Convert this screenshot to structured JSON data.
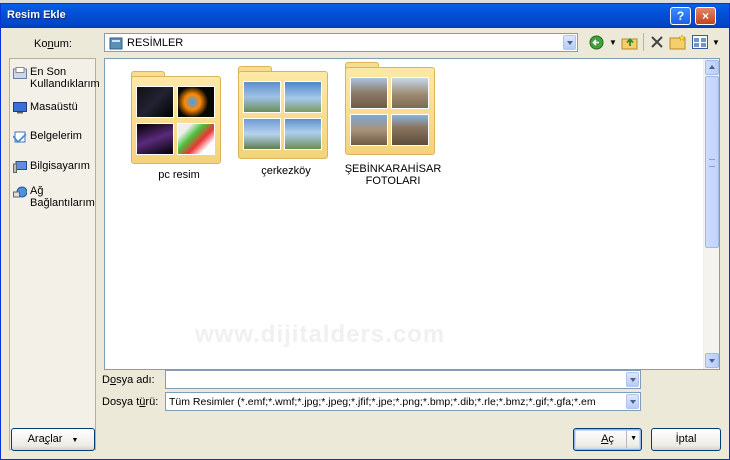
{
  "window": {
    "title": "Resim Ekle",
    "help_label": "?",
    "close_label": "×"
  },
  "location": {
    "label_prefix": "Ko",
    "label_underlined": "n",
    "label_suffix": "um:",
    "value": "RESİMLER"
  },
  "places": [
    {
      "name": "recent",
      "label": "En Son Kullandıklarım",
      "icon": "recent-documents-icon"
    },
    {
      "name": "desktop",
      "label": "Masaüstü",
      "icon": "desktop-icon"
    },
    {
      "name": "documents",
      "label": "Belgelerim",
      "icon": "my-documents-icon"
    },
    {
      "name": "computer",
      "label": "Bilgisayarım",
      "icon": "my-computer-icon"
    },
    {
      "name": "network",
      "label": "Ağ Bağlantılarım",
      "icon": "network-places-icon"
    }
  ],
  "folders": [
    {
      "name": "pc resim",
      "label": "pc resim"
    },
    {
      "name": "cerkezkoy",
      "label": "çerkezköy"
    },
    {
      "name": "sebinkarahisar",
      "label": "ŞEBİNKARAHİSAR FOTOLARI"
    }
  ],
  "filename": {
    "label_prefix": "D",
    "label_underlined": "o",
    "label_suffix": "sya adı:",
    "value": ""
  },
  "filetype": {
    "label_prefix": "Dosya t",
    "label_underlined": "ü",
    "label_suffix": "rü:",
    "value": "Tüm Resimler (*.emf;*.wmf;*.jpg;*.jpeg;*.jfif;*.jpe;*.png;*.bmp;*.dib;*.rle;*.bmz;*.gif;*.gfa;*.em"
  },
  "buttons": {
    "tools_prefix": "Ara",
    "tools_underlined": "ç",
    "tools_suffix": "lar",
    "open_underlined": "A",
    "open_suffix": "ç",
    "cancel": "İptal"
  },
  "watermark": "www.dijitalders.com",
  "colors": {
    "title_bar": "#0350d6",
    "dialog_bg": "#ece9d8",
    "folder": "#f4d27c"
  }
}
